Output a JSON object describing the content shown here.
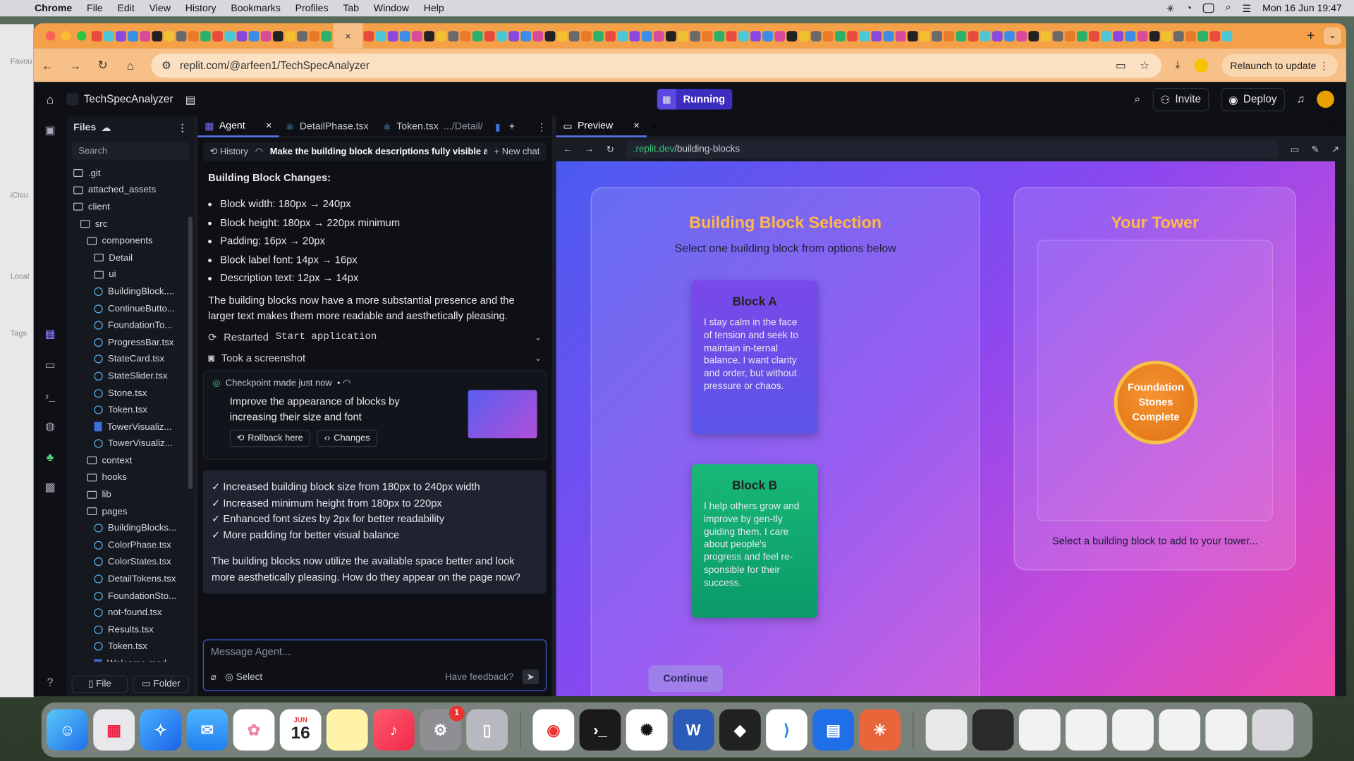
{
  "menubar": {
    "app": "Chrome",
    "items": [
      "File",
      "Edit",
      "View",
      "History",
      "Bookmarks",
      "Profiles",
      "Tab",
      "Window",
      "Help"
    ],
    "clock": "Mon 16 Jun  19:47"
  },
  "browser": {
    "url": "replit.com/@arfeen1/TechSpecAnalyzer",
    "relaunch": "Relaunch to update"
  },
  "sidebar_mac": {
    "favourites": "Favou",
    "icloud": "iClou",
    "locations": "Locat",
    "tags": "Tags"
  },
  "replit": {
    "project": "TechSpecAnalyzer",
    "status": "Running",
    "invite": "Invite",
    "deploy": "Deploy"
  },
  "files": {
    "title": "Files",
    "search_placeholder": "Search",
    "items": [
      {
        "name": ".git",
        "kind": "folder",
        "indent": 0
      },
      {
        "name": "attached_assets",
        "kind": "folder",
        "indent": 0
      },
      {
        "name": "client",
        "kind": "folder",
        "indent": 0
      },
      {
        "name": "src",
        "kind": "folder",
        "indent": 1
      },
      {
        "name": "components",
        "kind": "folder",
        "indent": 2
      },
      {
        "name": "Detail",
        "kind": "folder",
        "indent": 3
      },
      {
        "name": "ui",
        "kind": "folder",
        "indent": 3
      },
      {
        "name": "BuildingBlock....",
        "kind": "react",
        "indent": 3
      },
      {
        "name": "ContinueButto...",
        "kind": "react",
        "indent": 3
      },
      {
        "name": "FoundationTo...",
        "kind": "react",
        "indent": 3
      },
      {
        "name": "ProgressBar.tsx",
        "kind": "react",
        "indent": 3
      },
      {
        "name": "StateCard.tsx",
        "kind": "react",
        "indent": 3
      },
      {
        "name": "StateSlider.tsx",
        "kind": "react",
        "indent": 3
      },
      {
        "name": "Stone.tsx",
        "kind": "react",
        "indent": 3
      },
      {
        "name": "Token.tsx",
        "kind": "react",
        "indent": 3
      },
      {
        "name": "TowerVisualiz...",
        "kind": "ts",
        "indent": 3
      },
      {
        "name": "TowerVisualiz...",
        "kind": "react",
        "indent": 3
      },
      {
        "name": "context",
        "kind": "folder",
        "indent": 2
      },
      {
        "name": "hooks",
        "kind": "folder",
        "indent": 2
      },
      {
        "name": "lib",
        "kind": "folder",
        "indent": 2
      },
      {
        "name": "pages",
        "kind": "folder",
        "indent": 2
      },
      {
        "name": "BuildingBlocks...",
        "kind": "react",
        "indent": 3
      },
      {
        "name": "ColorPhase.tsx",
        "kind": "react",
        "indent": 3
      },
      {
        "name": "ColorStates.tsx",
        "kind": "react",
        "indent": 3
      },
      {
        "name": "DetailTokens.tsx",
        "kind": "react",
        "indent": 3
      },
      {
        "name": "FoundationSto...",
        "kind": "react",
        "indent": 3
      },
      {
        "name": "not-found.tsx",
        "kind": "react",
        "indent": 3
      },
      {
        "name": "Results.tsx",
        "kind": "react",
        "indent": 3
      },
      {
        "name": "Token.tsx",
        "kind": "react",
        "indent": 3
      },
      {
        "name": "Welcome.mod...",
        "kind": "ts",
        "indent": 3
      }
    ],
    "btn_file": "File",
    "btn_folder": "Folder"
  },
  "agent": {
    "tabs": [
      {
        "label": "Agent"
      },
      {
        "label": "DetailPhase.tsx"
      },
      {
        "label": "Token.tsx",
        "sub": ".../Detail/"
      }
    ],
    "history": "History",
    "chat_title": "Make the building block descriptions fully visible and ...",
    "new_chat": "New chat",
    "heading": "Building Block Changes:",
    "bullets": [
      "Block width: 180px → 240px",
      "Block height: 180px → 220px minimum",
      "Padding: 16px → 20px",
      "Block label font: 14px → 16px",
      "Description text: 12px → 14px"
    ],
    "para": "The building blocks now have a more substantial presence and the larger text makes them more readable and aesthetically pleasing.",
    "action1_prefix": "Restarted",
    "action1_mono": "Start application",
    "action2": "Took a screenshot",
    "checkpoint_label": "Checkpoint made just now",
    "checkpoint_text": "Improve the appearance of blocks by increasing their size and font",
    "rollback": "Rollback here",
    "changes": "Changes",
    "summary_lines": [
      "✓ Increased building block size from 180px to 240px width",
      "✓ Increased minimum height from 180px to 220px",
      "✓ Enhanced font sizes by 2px for better readability",
      "✓ More padding for better visual balance"
    ],
    "summary_para": "The building blocks now utilize the available space better and look more aesthetically pleasing. How do they appear on the page now?",
    "input_placeholder": "Message Agent...",
    "select": "Select",
    "feedback": "Have feedback?"
  },
  "preview": {
    "tab": "Preview",
    "url_host": ".replit.dev",
    "url_path": "/building-blocks",
    "selection_title": "Building Block Selection",
    "selection_sub": "Select one building block from options below",
    "block_a_title": "Block A",
    "block_a_desc": "I stay calm in the face of tension and seek to maintain in-ternal balance. I want clarity and order, but without pressure or chaos.",
    "block_b_title": "Block B",
    "block_b_desc": "I help others grow and improve by gen-tly guiding them. I care about people's progress and feel re-sponsible for their success.",
    "continue": "Continue",
    "tower_title": "Your Tower",
    "stone_label": "Foundation Stones Complete",
    "tower_hint": "Select a building block to add to your tower..."
  },
  "dock": {
    "calendar_month": "JUN",
    "calendar_day": "16",
    "settings_badge": "1"
  }
}
